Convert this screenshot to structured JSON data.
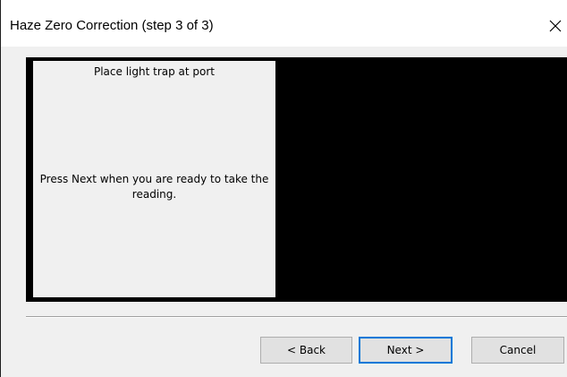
{
  "window": {
    "title": "Haze Zero Correction (step 3 of 3)",
    "close_icon": "close-icon"
  },
  "panel": {
    "heading": "Place light trap at port",
    "instruction": "Press Next when you are ready to take the reading."
  },
  "buttons": {
    "back_label": "< Back",
    "next_label": "Next >",
    "cancel_label": "Cancel"
  },
  "colors": {
    "preview_background": "#000000",
    "dialog_background": "#f0f0f0",
    "default_button_border": "#0078d7"
  }
}
